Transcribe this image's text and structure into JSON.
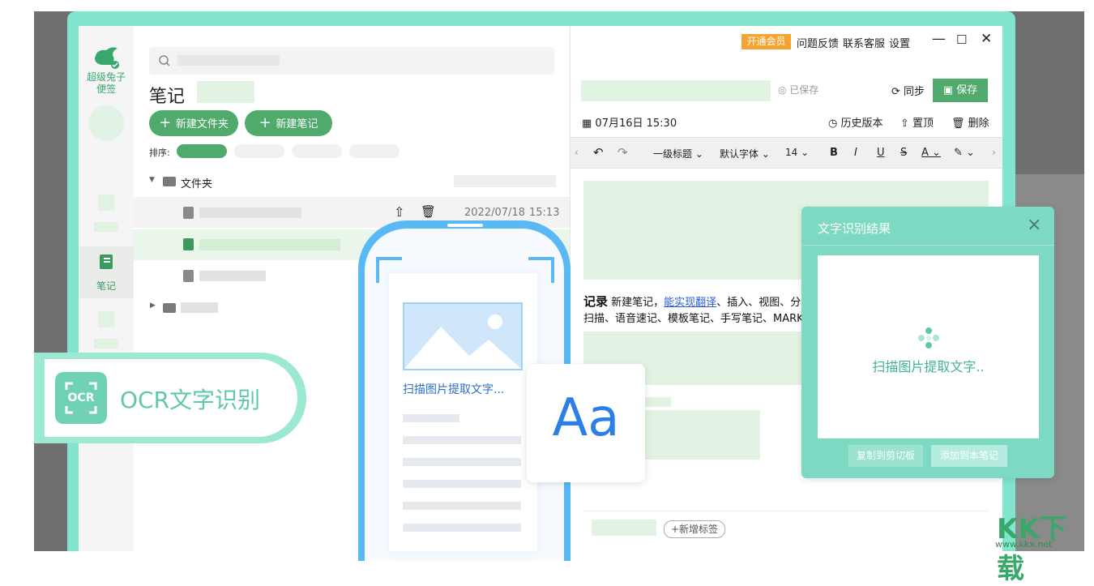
{
  "rail": {
    "app_name_line1": "超级兔子",
    "app_name_line2": "便签",
    "notes_label": "笔记"
  },
  "list": {
    "title": "笔记",
    "new_folder": "新建文件夹",
    "new_note": "新建笔记",
    "sort_label": "排序:",
    "folder_label": "文件夹",
    "row_date": "2022/07/18",
    "row_time": "15:13"
  },
  "topbar": {
    "vip": "开通会员",
    "feedback": "问题反馈",
    "support": "联系客服",
    "settings": "设置"
  },
  "editor": {
    "saved": "已保存",
    "sync": "同步",
    "save": "保存",
    "date": "07月16日 15:30",
    "history": "历史版本",
    "pin": "置顶",
    "delete": "删除",
    "heading": "一级标题",
    "font": "默认字体",
    "font_size": "14",
    "line1_bold": "记录",
    "line1_a": "新建笔记，",
    "line1_link": "能实现翻译",
    "line1_b": "、插入、视图、分享、",
    "line2": "扫描、语音速记、模板笔记、手写笔记、MARKDOW",
    "add_tag": "+新增标签"
  },
  "dialog": {
    "title": "文字识别结果",
    "scanning": "扫描图片提取文字..",
    "copy": "复制到剪切板",
    "add": "添加到本笔记"
  },
  "badge": {
    "icon_text": "OCR",
    "label": "OCR文字识别"
  },
  "phone": {
    "caption": "扫描图片提取文字...",
    "aa": "Aa"
  },
  "watermark": {
    "main": "KK下载",
    "sub": "www.kkx.net"
  },
  "colors": {
    "accent": "#4faa6c",
    "frame": "#82e6cf",
    "vip": "#f6a332",
    "ocr": "#6fd2b7"
  }
}
